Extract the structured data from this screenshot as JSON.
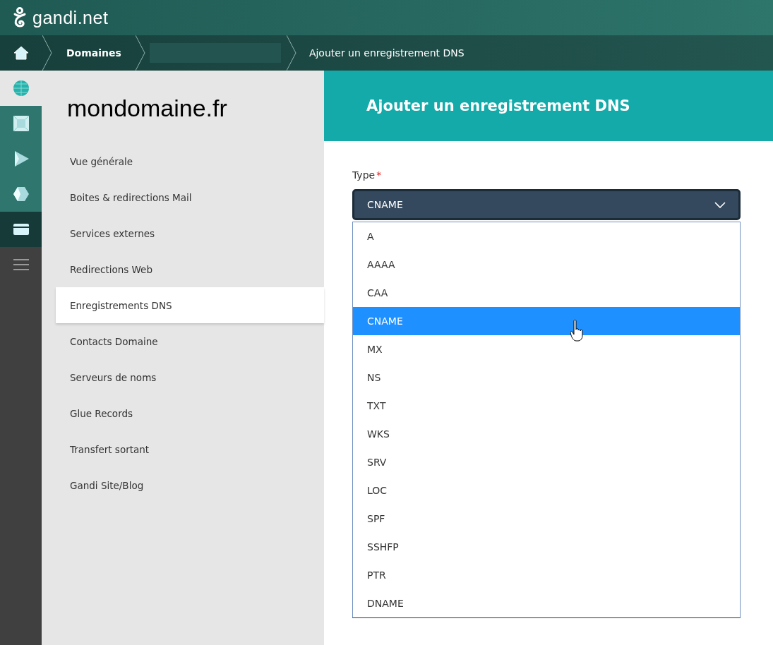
{
  "header": {
    "logo_text": "gandi.net"
  },
  "breadcrumb": [
    {
      "kind": "home"
    },
    {
      "kind": "link",
      "label": "Domaines"
    },
    {
      "kind": "hidden"
    },
    {
      "kind": "current",
      "label": "Ajouter un enregistrement DNS"
    }
  ],
  "rail": [
    {
      "kind": "globe",
      "selected": false
    },
    {
      "kind": "square",
      "selected": false
    },
    {
      "kind": "play",
      "selected": false
    },
    {
      "kind": "cube",
      "selected": false
    },
    {
      "kind": "card",
      "selected": true
    },
    {
      "kind": "menu",
      "selected": false
    }
  ],
  "sidebar": {
    "title": "mondomaine.fr",
    "items": [
      {
        "label": "Vue générale",
        "selected": false
      },
      {
        "label": "Boites & redirections Mail",
        "selected": false
      },
      {
        "label": "Services externes",
        "selected": false
      },
      {
        "label": "Redirections Web",
        "selected": false
      },
      {
        "label": "Enregistrements DNS",
        "selected": true
      },
      {
        "label": "Contacts Domaine",
        "selected": false
      },
      {
        "label": "Serveurs de noms",
        "selected": false
      },
      {
        "label": "Glue Records",
        "selected": false
      },
      {
        "label": "Transfert sortant",
        "selected": false
      },
      {
        "label": "Gandi Site/Blog",
        "selected": false
      }
    ]
  },
  "panel": {
    "title": "Ajouter un enregistrement DNS",
    "field": {
      "label": "Type",
      "required_mark": "*",
      "value": "CNAME",
      "expanded": true,
      "options": [
        {
          "label": "A",
          "selected": false
        },
        {
          "label": "AAAA",
          "selected": false
        },
        {
          "label": "CAA",
          "selected": false
        },
        {
          "label": "CNAME",
          "selected": true
        },
        {
          "label": "MX",
          "selected": false
        },
        {
          "label": "NS",
          "selected": false
        },
        {
          "label": "TXT",
          "selected": false
        },
        {
          "label": "WKS",
          "selected": false
        },
        {
          "label": "SRV",
          "selected": false
        },
        {
          "label": "LOC",
          "selected": false
        },
        {
          "label": "SPF",
          "selected": false
        },
        {
          "label": "SSHFP",
          "selected": false
        },
        {
          "label": "PTR",
          "selected": false
        },
        {
          "label": "DNAME",
          "selected": false
        }
      ]
    }
  }
}
